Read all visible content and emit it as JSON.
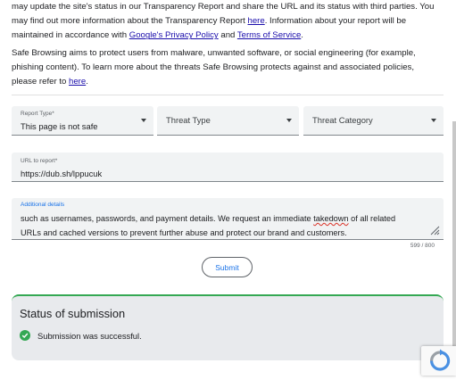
{
  "intro": {
    "paragraph1": {
      "line1": "may update the site's status in our Transparency Report and share the URL and its status with third parties. You",
      "line2_before": "may find out more information about the Transparency Report ",
      "line2_link": "here",
      "line2_after": ". Information about your report will be",
      "line3_before": "maintained in accordance with ",
      "line3_link1": "Google's Privacy Policy",
      "line3_mid": " and ",
      "line3_link2": "Terms of Service",
      "line3_after": "."
    },
    "paragraph2": {
      "line1": "Safe Browsing aims to protect users from malware, unwanted software, or social engineering (for example,",
      "line2": "phishing content). To learn more about the threats Safe Browsing protects against and associated policies,",
      "line3_before": "please refer to ",
      "line3_link": "here",
      "line3_after": "."
    }
  },
  "form": {
    "report_type": {
      "label": "Report Type*",
      "value": "This page is not safe"
    },
    "threat_type": {
      "placeholder": "Threat Type"
    },
    "threat_category": {
      "placeholder": "Threat Category"
    },
    "url": {
      "label": "URL to report*",
      "value": "https://dub.sh/lppucuk"
    },
    "details": {
      "label": "Additional details",
      "line1_before": "such as usernames, passwords, and payment details. We request an immediate ",
      "line1_misspelled": "takedown",
      "line1_after": " of all related",
      "line2": "URLs and cached versions to prevent further abuse and protect our brand and customers.",
      "counter": "599 / 800"
    },
    "submit_label": "Submit"
  },
  "status": {
    "title": "Status of submission",
    "message": "Submission was successful.",
    "icon": "check-circle-icon"
  },
  "colors": {
    "link": "#1a0dab",
    "accent": "#1a73e8",
    "success": "#34a853",
    "field_bg": "#f1f3f4",
    "card_bg": "#e8eaed"
  }
}
